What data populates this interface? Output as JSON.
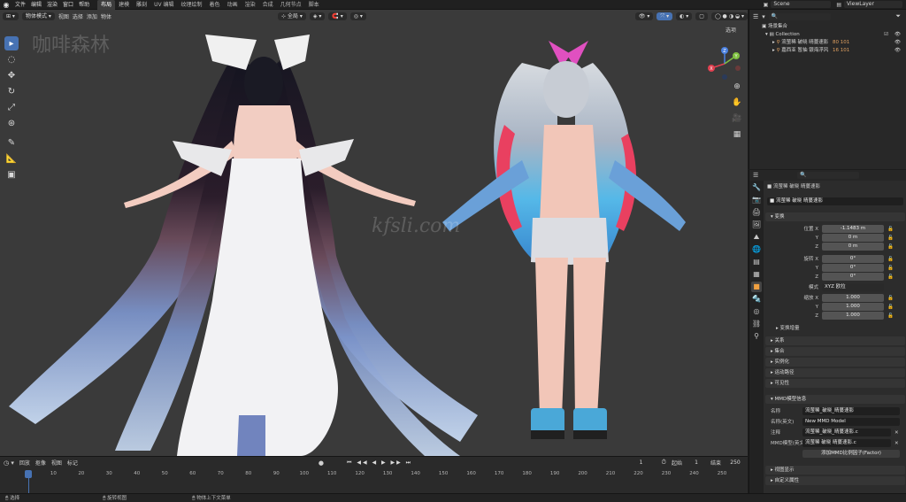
{
  "topbar": {
    "menus": [
      "文件",
      "编辑",
      "渲染",
      "窗口",
      "帮助"
    ],
    "workspaces": [
      "布局",
      "建模",
      "雕刻",
      "UV 编辑",
      "纹理绘制",
      "着色",
      "动画",
      "渲染",
      "合成",
      "几何节点",
      "脚本"
    ],
    "active_workspace": "布局",
    "scene_label": "Scene",
    "viewlayer_label": "ViewLayer"
  },
  "viewport": {
    "mode": "物体模式",
    "menus": [
      "视图",
      "选择",
      "添加",
      "物体"
    ],
    "transform_orientation": "全局",
    "options_label": "选项",
    "watermark_top": "咖啡森林",
    "watermark_center": "kfsli.com",
    "tools": [
      "select-tool",
      "cursor-tool",
      "move-tool",
      "rotate-tool",
      "scale-tool",
      "transform-tool",
      "annotate-tool",
      "measure-tool",
      "add-cube-tool"
    ],
    "axes": {
      "x": "X",
      "y": "Y",
      "z": "Z"
    }
  },
  "outliner": {
    "title": "场景集合",
    "collection": "Collection",
    "items": [
      {
        "name": "流萤稀 破晓 晴蔓速影",
        "extra": "80 101"
      },
      {
        "name": "嘉西亚 暂抽 银海浮风",
        "extra": "16 101"
      }
    ]
  },
  "properties": {
    "object_name": "流萤稀 破晓 晴蔓速影",
    "object_name2": "流萤稀 破晓 晴蔓速影",
    "transform_header": "变换",
    "location_label": "位置 X",
    "location": [
      "-1.1483 m",
      "0 m",
      "0 m"
    ],
    "rotation_label": "旋转 X",
    "rotation": [
      "0°",
      "0°",
      "0°"
    ],
    "mode_label": "模式",
    "mode_value": "XYZ 欧拉",
    "scale_label": "缩放 X",
    "scale": [
      "1.000",
      "1.000",
      "1.000"
    ],
    "axis_y": "Y",
    "axis_z": "Z",
    "delta_label": "变换增量",
    "sections": [
      "关系",
      "集合",
      "实例化",
      "运动路径",
      "可见性"
    ],
    "mmd_header": "MMD模型信息",
    "mmd_name_label": "名称",
    "mmd_name_value": "流萤稀_破晓_晴蔓速影",
    "mmd_name_en_label": "名称(英文)",
    "mmd_name_en_value": "New MMD Model",
    "mmd_comment_label": "注释",
    "mmd_comment_value": "流萤稀_破晓_晴蔓速影.c",
    "mmd_comment_en_label": "MMD模型(英文)",
    "mmd_comment_en_value": "流萤稀 破晓 晴蔓速影.c",
    "mmd_factor": "添加MMD比例因子(Factor)",
    "viewport_display": "视图显示",
    "custom_props": "自定义属性"
  },
  "timeline": {
    "menus": [
      "回放",
      "抠像",
      "视图",
      "标记"
    ],
    "current_frame": "1",
    "start_label": "起始",
    "start": "1",
    "end_label": "结束",
    "end": "250",
    "ticks": [
      "1",
      "10",
      "20",
      "30",
      "40",
      "50",
      "60",
      "70",
      "80",
      "90",
      "100",
      "110",
      "120",
      "130",
      "140",
      "150",
      "160",
      "170",
      "180",
      "190",
      "200",
      "210",
      "220",
      "230",
      "240",
      "250"
    ]
  },
  "statusbar": {
    "items": [
      "选择",
      "旋转视图",
      "物体上下文菜单"
    ]
  }
}
